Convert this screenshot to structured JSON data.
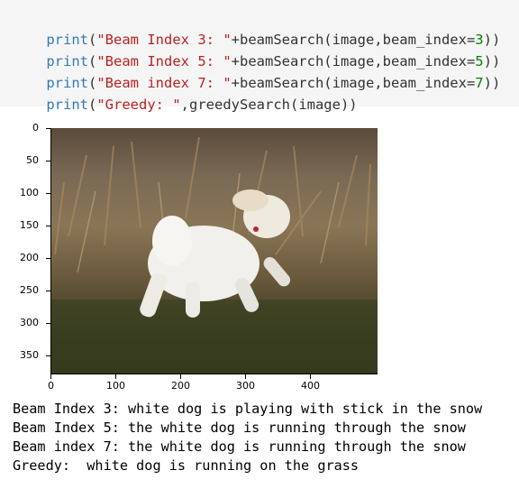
{
  "code": {
    "line1": {
      "fn": "print",
      "open": "(",
      "str": "\"Beam Index 3: \"",
      "concat": "+beamSearch(image,beam_index=",
      "num": "3",
      "close": "))"
    },
    "line2": {
      "fn": "print",
      "open": "(",
      "str": "\"Beam Index 5: \"",
      "concat": "+beamSearch(image,beam_index=",
      "num": "5",
      "close": "))"
    },
    "line3": {
      "fn": "print",
      "open": "(",
      "str": "\"Beam index 7: \"",
      "concat": "+beamSearch(image,beam_index=",
      "num": "7",
      "close": "))"
    },
    "line4": {
      "fn": "print",
      "open": "(",
      "str": "\"Greedy: \"",
      "concat": ",greedySearch(image))",
      "num": "",
      "close": ""
    }
  },
  "plot": {
    "y_ticks": [
      "0",
      "50",
      "100",
      "150",
      "200",
      "250",
      "300",
      "350"
    ],
    "x_ticks": [
      "0",
      "100",
      "200",
      "300",
      "400"
    ]
  },
  "output": {
    "line1": "Beam Index 3: white dog is playing with stick in the snow",
    "line2": "Beam Index 5: the white dog is running through the snow",
    "line3": "Beam index 7: the white dog is running through the snow",
    "line4": "Greedy:  white dog is running on the grass"
  },
  "colors": {
    "builtin": "#337ab7",
    "string": "#ba2121",
    "number": "#008000",
    "cell_bg": "#f5f5f5"
  }
}
